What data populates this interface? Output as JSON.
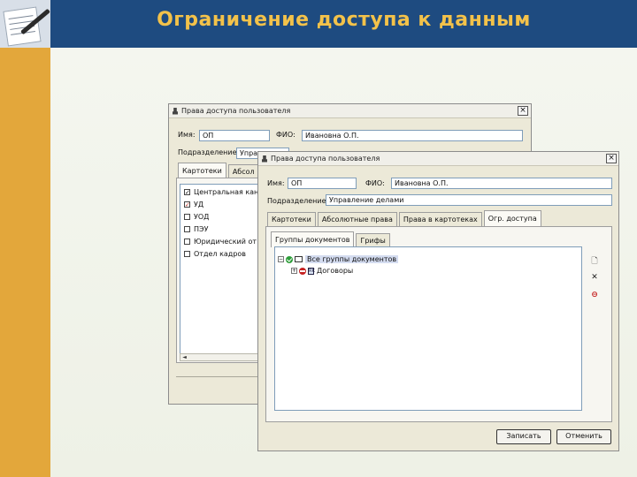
{
  "slide": {
    "title": "Ограничение доступа к данным"
  },
  "back_window": {
    "title": "Права доступа пользователя",
    "close_label": "×",
    "name_label": "Имя:",
    "name_value": "ОП",
    "fio_label": "ФИО:",
    "fio_value": "Ивановна О.П.",
    "dept_label": "Подразделение:",
    "dept_value": "Управ",
    "tabs": [
      "Картотеки",
      "Абсол"
    ],
    "checklist": [
      {
        "label": "Центральная кан",
        "state": "on"
      },
      {
        "label": "УД",
        "state": "red"
      },
      {
        "label": "УОД",
        "state": "off"
      },
      {
        "label": "ПЭУ",
        "state": "off"
      },
      {
        "label": "Юридический от",
        "state": "off"
      },
      {
        "label": "Отдел кадров",
        "state": "off"
      }
    ],
    "scroll_left": "◄"
  },
  "front_window": {
    "title": "Права доступа пользователя",
    "close_label": "×",
    "name_label": "Имя:",
    "name_value": "ОП",
    "fio_label": "ФИО:",
    "fio_value": "Ивановна О.П.",
    "dept_label": "Подразделение:",
    "dept_value": "Управление делами",
    "tabs": [
      "Картотеки",
      "Абсолютные права",
      "Права в картотеках",
      "Огр. доступа"
    ],
    "subtabs": [
      "Группы документов",
      "Грифы"
    ],
    "tree": {
      "root_expander": "−",
      "root_label": "Все группы документов",
      "child_expander": "+",
      "child_doc_label": "RK",
      "child_label": "Договоры"
    },
    "tools": {
      "add": "🗋",
      "remove": "✕",
      "deny": "⊖"
    },
    "buttons": {
      "save": "Записать",
      "cancel": "Отменить"
    },
    "colors": {
      "add_icon": "#333333",
      "remove_icon": "#222222",
      "deny_icon": "#c52222"
    }
  }
}
